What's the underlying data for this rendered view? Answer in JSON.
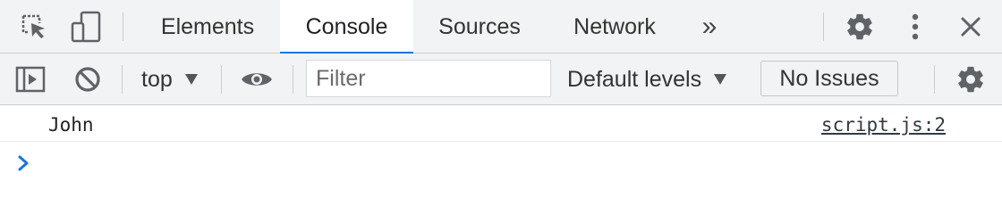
{
  "tabbar": {
    "tabs": [
      {
        "label": "Elements",
        "active": false
      },
      {
        "label": "Console",
        "active": true
      },
      {
        "label": "Sources",
        "active": false
      },
      {
        "label": "Network",
        "active": false
      }
    ],
    "more_tabs_glyph": "»",
    "icons": [
      "inspect-element-icon",
      "device-toolbar-icon",
      "settings-gear-icon",
      "more-vertical-icon",
      "close-icon"
    ]
  },
  "toolbar": {
    "context": "top",
    "filter_placeholder": "Filter",
    "filter_value": "",
    "levels_label": "Default levels",
    "issues_label": "No Issues",
    "icons": [
      "show-sidebar-icon",
      "clear-console-icon",
      "live-expression-eye-icon",
      "console-settings-gear-icon"
    ]
  },
  "console": {
    "messages": [
      {
        "text": "John",
        "source": "script.js:2"
      }
    ],
    "prompt_value": ""
  },
  "colors": {
    "toolbar_bg": "#f1f3f4",
    "active_tab_underline": "#1a73e8",
    "prompt_caret": "#1a73e8",
    "icon": "#5f6368"
  }
}
